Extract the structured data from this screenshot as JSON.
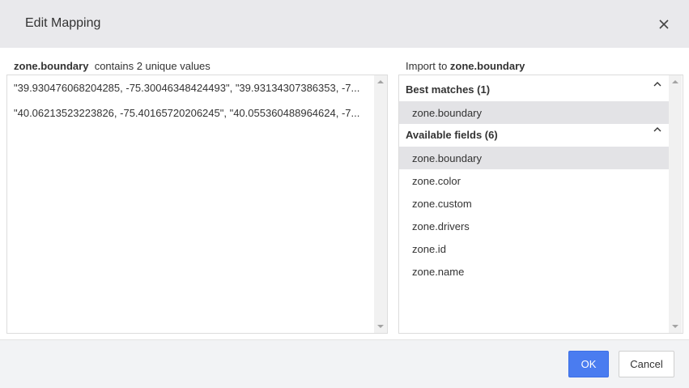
{
  "dialog": {
    "title": "Edit Mapping",
    "close_icon": "close-icon"
  },
  "source": {
    "field_name": "zone.boundary",
    "summary": "contains 2 unique values",
    "values": [
      "\"39.930476068204285, -75.30046348424493\", \"39.93134307386353, -7...",
      "\"40.06213523223826, -75.40165720206245\", \"40.055360488964624, -7..."
    ]
  },
  "target": {
    "label_prefix": "Import to",
    "field_name": "zone.boundary",
    "best_matches": {
      "label": "Best matches (1)",
      "items": [
        "zone.boundary"
      ]
    },
    "available_fields": {
      "label": "Available fields (6)",
      "items": [
        "zone.boundary",
        "zone.color",
        "zone.custom",
        "zone.drivers",
        "zone.id",
        "zone.name"
      ]
    },
    "selected_color": "#e3e3e6"
  },
  "footer": {
    "ok_label": "OK",
    "cancel_label": "Cancel",
    "ok_color": "#4a7cf0"
  }
}
